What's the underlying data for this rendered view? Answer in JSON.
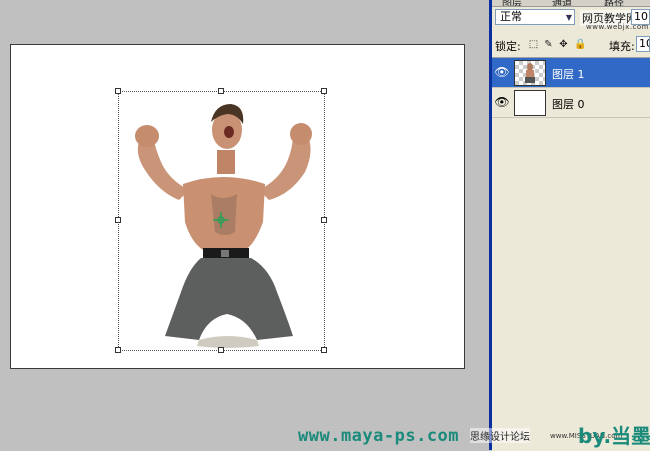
{
  "panel": {
    "tabs": [
      "图层",
      "通道",
      "路径"
    ],
    "blend_mode": "正常",
    "opacity_value": "10",
    "watermark_cn": "网页教学网",
    "watermark_url": "www.webjx.com",
    "lock_label": "锁定:",
    "fill_label": "填充:",
    "fill_value": "10"
  },
  "layers": [
    {
      "name": "图层 1",
      "selected": true,
      "thumbnail": "person-thumbnail"
    },
    {
      "name": "图层 0",
      "selected": false,
      "thumbnail": "blank-thumbnail"
    }
  ],
  "footer": {
    "site": "www.maya-ps.com",
    "forum": "思缘设计论坛",
    "forum_url": "www.MISSYUAN.com",
    "byline": "by.当墨"
  },
  "colors": {
    "workspace": "#c0c0c0",
    "selected_row": "#3169c6",
    "panel_bg": "#ece9d8",
    "watermark": "#1a8a7a"
  }
}
